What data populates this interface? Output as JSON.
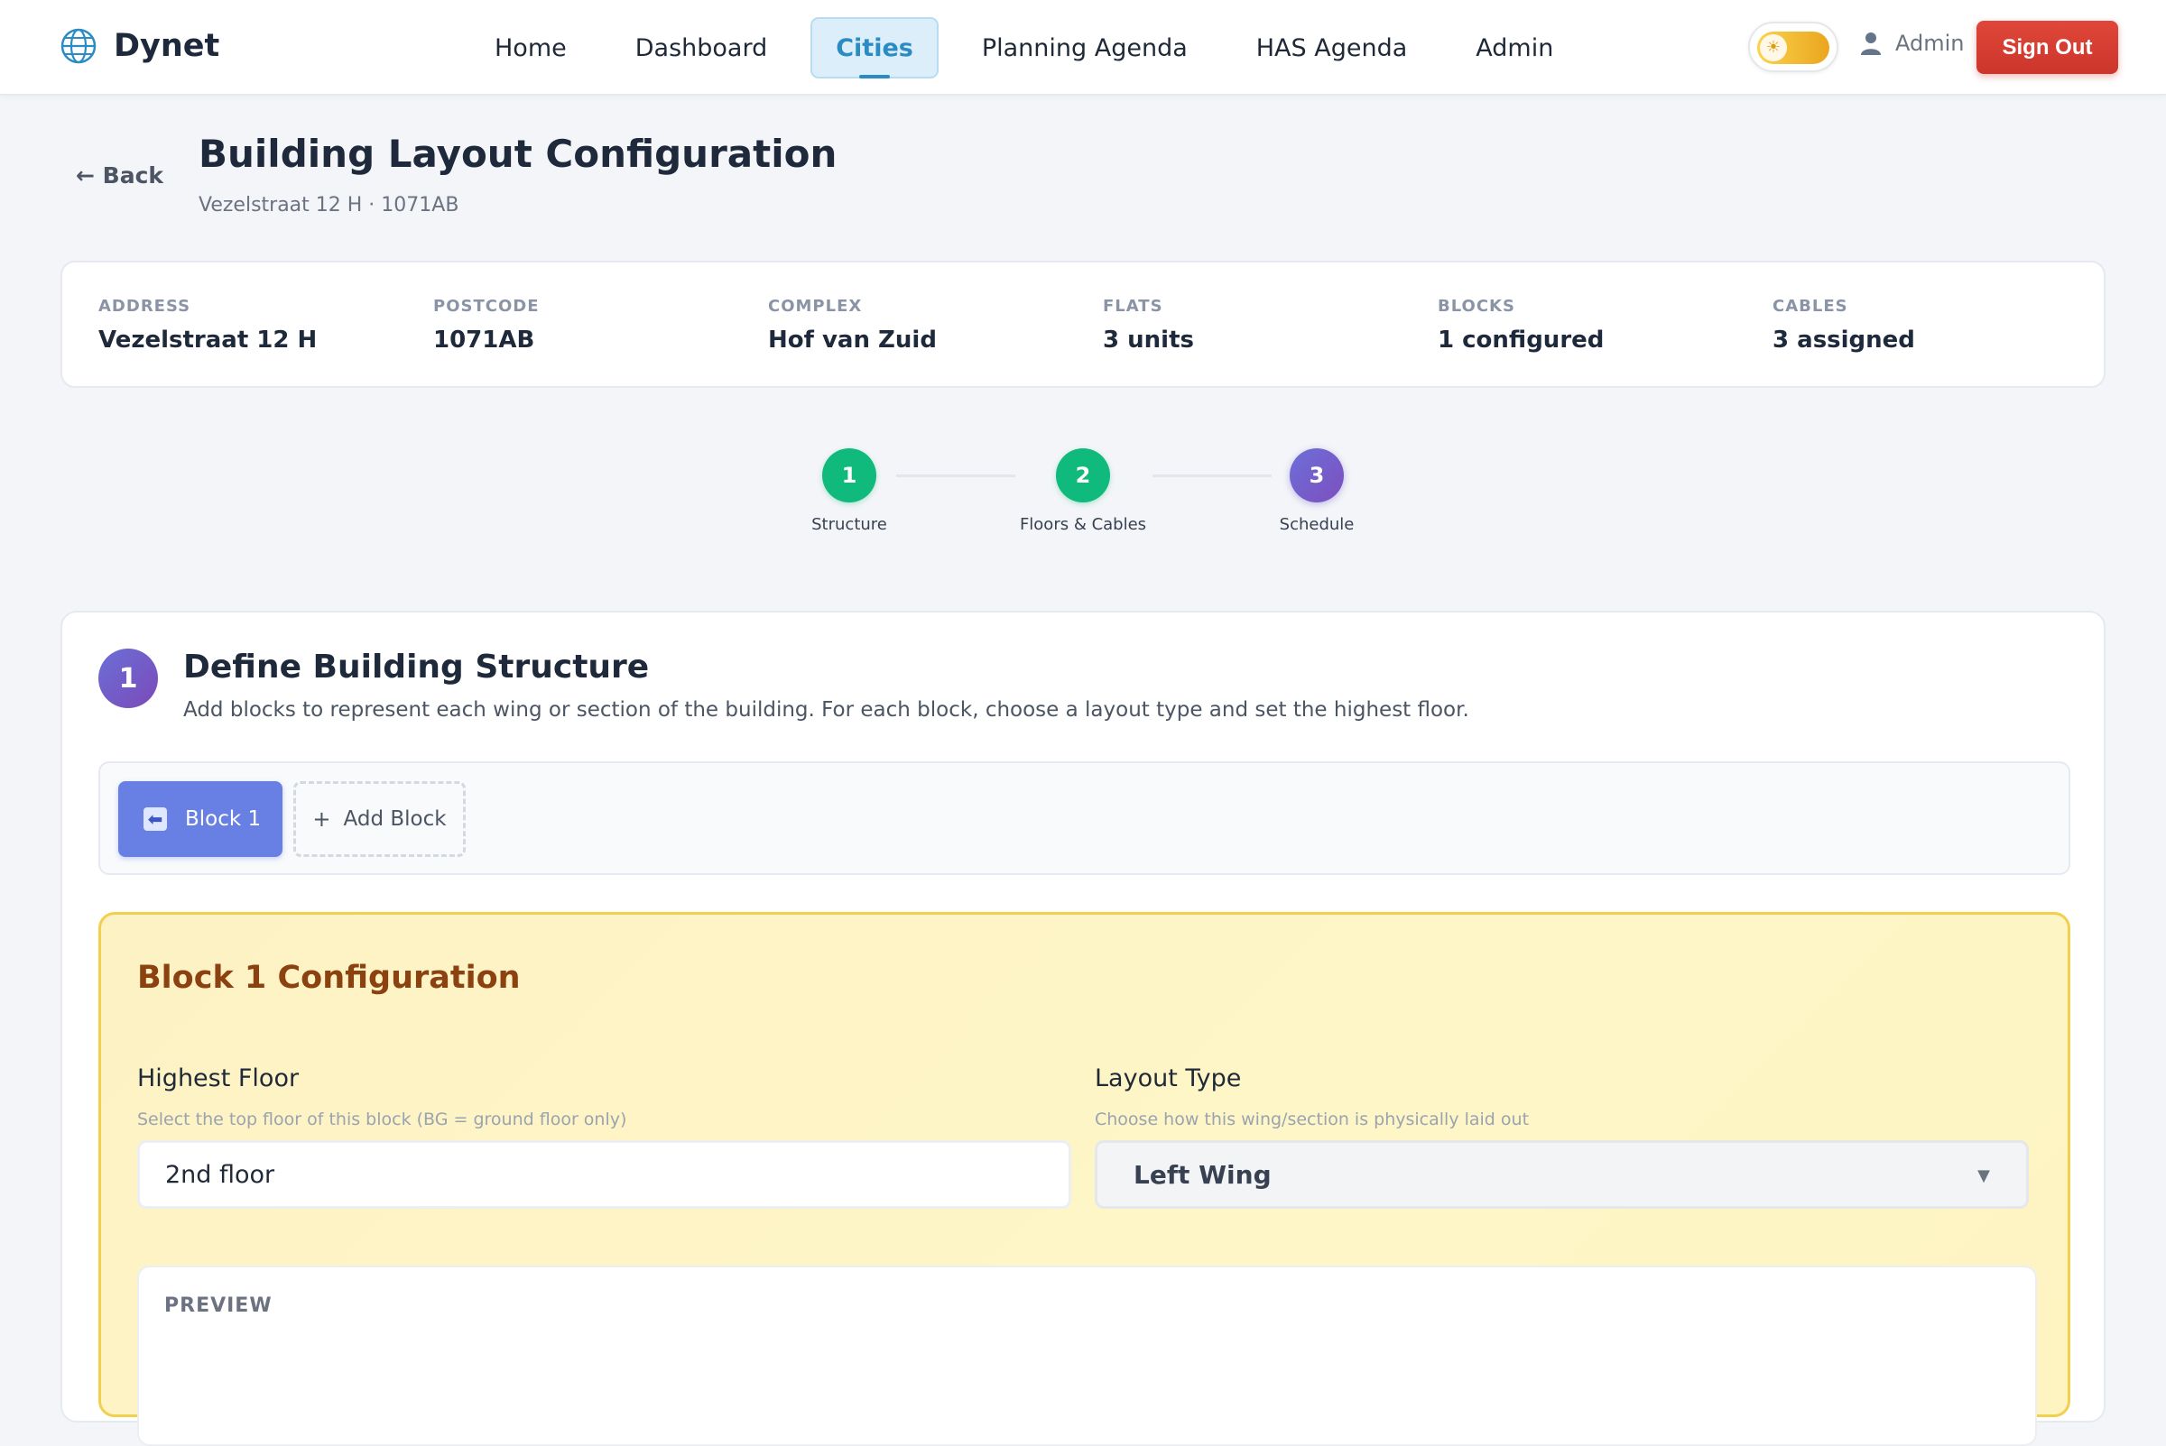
{
  "nav": {
    "brand": "Dynet",
    "links": [
      {
        "label": "Home",
        "active": false
      },
      {
        "label": "Dashboard",
        "active": false
      },
      {
        "label": "Cities",
        "active": true
      },
      {
        "label": "Planning Agenda",
        "active": false
      },
      {
        "label": "HAS Agenda",
        "active": false
      },
      {
        "label": "Admin",
        "active": false
      }
    ],
    "user": "Admin",
    "sign_out": "Sign Out",
    "theme": "light"
  },
  "header": {
    "back": "← Back",
    "title": "Building Layout Configuration",
    "subtitle": "Vezelstraat 12 H · 1071AB"
  },
  "info": [
    {
      "label": "ADDRESS",
      "value": "Vezelstraat 12 H"
    },
    {
      "label": "POSTCODE",
      "value": "1071AB"
    },
    {
      "label": "COMPLEX",
      "value": "Hof van Zuid"
    },
    {
      "label": "FLATS",
      "value": "3 units"
    },
    {
      "label": "BLOCKS",
      "value": "1 configured"
    },
    {
      "label": "CABLES",
      "value": "3 assigned"
    }
  ],
  "steps": [
    {
      "num": "1",
      "label": "Structure",
      "state": "done"
    },
    {
      "num": "2",
      "label": "Floors & Cables",
      "state": "done"
    },
    {
      "num": "3",
      "label": "Schedule",
      "state": "current"
    }
  ],
  "section": {
    "num": "1",
    "title": "Define Building Structure",
    "description": "Add blocks to represent each wing or section of the building. For each block, choose a layout type and set the highest floor."
  },
  "blocks": {
    "items": [
      {
        "label": "Block 1",
        "icon": "⬅"
      }
    ],
    "add_label": "Add Block",
    "add_icon": "+"
  },
  "config": {
    "title": "Block 1 Configuration",
    "highest_floor": {
      "label": "Highest Floor",
      "hint": "Select the top floor of this block (BG = ground floor only)",
      "value": "2nd floor"
    },
    "layout_type": {
      "label": "Layout Type",
      "hint": "Choose how this wing/section is physically laid out",
      "value": "Left Wing"
    },
    "preview_label": "PREVIEW"
  },
  "colors": {
    "accent": "#2b8cc4",
    "danger": "#d63d31",
    "success": "#10b97c",
    "primary": "#6d5fd0",
    "block_tab": "#6880e4",
    "config_bg": "#fef3c5",
    "config_border": "#f2cf4d",
    "config_title": "#8c4210"
  }
}
